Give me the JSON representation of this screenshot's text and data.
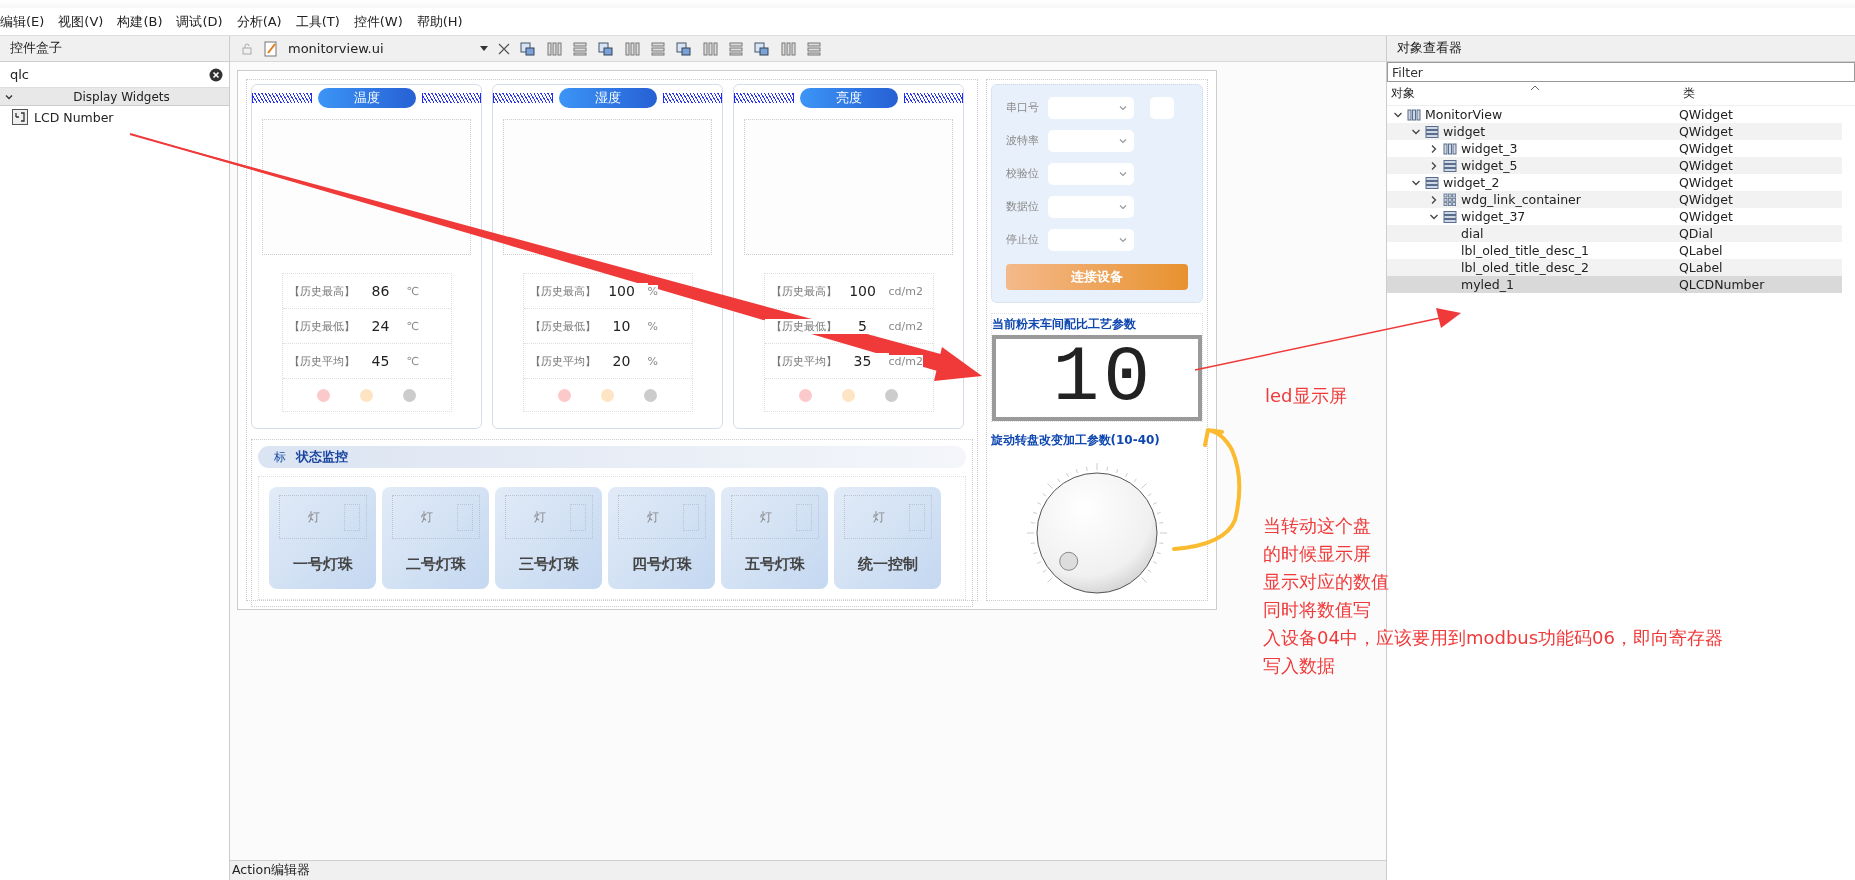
{
  "menu_bar": [
    {
      "label": "编辑(E)"
    },
    {
      "label": "视图(V)"
    },
    {
      "label": "构建(B)"
    },
    {
      "label": "调试(D)"
    },
    {
      "label": "分析(A)"
    },
    {
      "label": "工具(T)"
    },
    {
      "label": "控件(W)"
    },
    {
      "label": "帮助(H)"
    }
  ],
  "widget_box": {
    "title": "控件盒子",
    "search": {
      "value": "qlc"
    },
    "category": {
      "label": "Display Widgets",
      "expanded": true
    },
    "items": [
      {
        "label": "LCD Number"
      }
    ]
  },
  "editor_toolbar": {
    "file": "monitorview.ui"
  },
  "form": {
    "panels": [
      {
        "title": "温度",
        "stats": [
          {
            "label": "【历史最高】",
            "value": "86",
            "unit": "℃"
          },
          {
            "label": "【历史最低】",
            "value": "24",
            "unit": "℃"
          },
          {
            "label": "【历史平均】",
            "value": "45",
            "unit": "℃"
          }
        ],
        "lights": [
          {
            "color": "#fbc9c9"
          },
          {
            "color": "#fde4c3"
          },
          {
            "color": "#cccccc"
          }
        ]
      },
      {
        "title": "湿度",
        "stats": [
          {
            "label": "【历史最高】",
            "value": "100",
            "unit": "%"
          },
          {
            "label": "【历史最低】",
            "value": "10",
            "unit": "%"
          },
          {
            "label": "【历史平均】",
            "value": "20",
            "unit": "%"
          }
        ],
        "lights": [
          {
            "color": "#fbc9c9"
          },
          {
            "color": "#fde4c3"
          },
          {
            "color": "#cccccc"
          }
        ]
      },
      {
        "title": "亮度",
        "stats": [
          {
            "label": "【历史最高】",
            "value": "100",
            "unit": "cd/m2"
          },
          {
            "label": "【历史最低】",
            "value": "5",
            "unit": "cd/m2"
          },
          {
            "label": "【历史平均】",
            "value": "35",
            "unit": "cd/m2"
          }
        ],
        "lights": [
          {
            "color": "#fbc9c9"
          },
          {
            "color": "#fde4c3"
          },
          {
            "color": "#cccccc"
          }
        ]
      }
    ],
    "status_section": {
      "icon_text": "标",
      "title": "状态监控",
      "buttons": [
        {
          "icon_text": "灯",
          "label": "一号灯珠"
        },
        {
          "icon_text": "灯",
          "label": "二号灯珠"
        },
        {
          "icon_text": "灯",
          "label": "三号灯珠"
        },
        {
          "icon_text": "灯",
          "label": "四号灯珠"
        },
        {
          "icon_text": "灯",
          "label": "五号灯珠"
        },
        {
          "icon_text": "灯",
          "label": "统一控制"
        }
      ]
    },
    "serial": {
      "fields": [
        {
          "label": "串口号"
        },
        {
          "label": "波特率"
        },
        {
          "label": "校验位"
        },
        {
          "label": "数据位"
        },
        {
          "label": "停止位"
        }
      ],
      "connect": "连接设备"
    },
    "lcd": {
      "title": "当前粉末车间配比工艺参数",
      "value": "10"
    },
    "dial": {
      "title": "旋动转盘改变加工参数(10-40)"
    }
  },
  "object_inspector": {
    "title": "对象查看器",
    "filter": {
      "placeholder": "Filter"
    },
    "columns": [
      "对象",
      "类"
    ],
    "tree": [
      {
        "name": "MonitorView",
        "class": "QWidget",
        "kind": "hbox",
        "expanded": true,
        "selected": false,
        "children": [
          {
            "name": "widget",
            "class": "QWidget",
            "kind": "vbox",
            "expanded": true,
            "selected": false,
            "children": [
              {
                "name": "widget_3",
                "class": "QWidget",
                "kind": "hbox",
                "expanded": false,
                "selected": false
              },
              {
                "name": "widget_5",
                "class": "QWidget",
                "kind": "vbox",
                "expanded": false,
                "selected": false
              }
            ]
          },
          {
            "name": "widget_2",
            "class": "QWidget",
            "kind": "vbox",
            "expanded": true,
            "selected": false,
            "children": [
              {
                "name": "wdg_link_container",
                "class": "QWidget",
                "kind": "grid",
                "expanded": false,
                "selected": false
              },
              {
                "name": "widget_37",
                "class": "QWidget",
                "kind": "vbox",
                "expanded": true,
                "selected": false,
                "children": [
                  {
                    "name": "dial",
                    "class": "QDial",
                    "selected": false
                  },
                  {
                    "name": "lbl_oled_title_desc_1",
                    "class": "QLabel",
                    "selected": false
                  },
                  {
                    "name": "lbl_oled_title_desc_2",
                    "class": "QLabel",
                    "selected": false
                  },
                  {
                    "name": "myled_1",
                    "class": "QLCDNumber",
                    "selected": true
                  }
                ]
              }
            ]
          }
        ]
      }
    ]
  },
  "annotations": {
    "led_label": "led显示屏",
    "note": [
      "当转动这个盘",
      "的时候显示屏",
      "显示对应的数值",
      "同时将数值写",
      "入设备04中，应该要用到modbus功能码06，即向寄存器",
      "写入数据"
    ]
  },
  "action_editor": {
    "title": "Action编辑器"
  }
}
